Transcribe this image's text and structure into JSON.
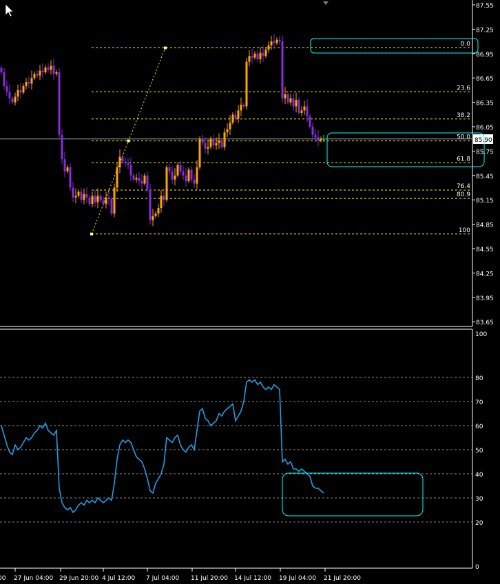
{
  "colors": {
    "background": "#000000",
    "bull": "#ffa500",
    "bear": "#8a2be2",
    "doji": "#00ff00",
    "fib": "#ffff00",
    "bid_line": "#a0a0a0",
    "highlight_box": "#00ffff",
    "rsi_line": "#1e9fe8",
    "grid": "#c0c0c0",
    "axis_text": "#ffffff"
  },
  "price_axis": {
    "labels": [
      "87.55",
      "87.25",
      "86.95",
      "86.65",
      "86.35",
      "86.05",
      "85.75",
      "85.45",
      "85.15",
      "84.85",
      "84.55",
      "84.25",
      "83.95",
      "83.65"
    ],
    "current_price": "85.90"
  },
  "time_axis": {
    "labels": [
      "00",
      "27 Jun 04:00",
      "29 Jun 20:00",
      "4 Jul 12:00",
      "7 Jul 04:00",
      "11 Jul 20:00",
      "14 Jul 12:00",
      "19 Jul 04:00",
      "21 Jul 20:00"
    ]
  },
  "fibonacci": {
    "high": 87.02,
    "low": 84.73,
    "levels": [
      "0.0",
      "23.6",
      "38.2",
      "50.0",
      "61.8",
      "76.4",
      "80.9",
      "100"
    ]
  },
  "closes": [
    86.72,
    86.55,
    86.48,
    86.4,
    86.35,
    86.42,
    86.5,
    86.47,
    86.55,
    86.6,
    86.58,
    86.65,
    86.7,
    86.68,
    86.74,
    86.72,
    86.78,
    86.75,
    86.8,
    86.7,
    86.72,
    85.95,
    85.65,
    85.5,
    85.55,
    85.3,
    85.18,
    85.2,
    85.25,
    85.15,
    85.22,
    85.18,
    85.1,
    85.2,
    85.12,
    85.2,
    85.14,
    85.1,
    85.18,
    85.16,
    84.98,
    85.3,
    85.55,
    85.68,
    85.62,
    85.6,
    85.58,
    85.45,
    85.4,
    85.42,
    85.38,
    85.35,
    85.45,
    85.28,
    84.9,
    84.95,
    84.98,
    85.05,
    85.2,
    85.15,
    85.55,
    85.5,
    85.4,
    85.45,
    85.58,
    85.5,
    85.45,
    85.38,
    85.52,
    85.4,
    85.35,
    85.55,
    85.9,
    85.85,
    85.78,
    85.8,
    85.9,
    85.82,
    85.85,
    85.88,
    85.8,
    85.98,
    86.02,
    86.1,
    86.2,
    86.15,
    86.25,
    86.32,
    86.3,
    86.85,
    86.92,
    86.9,
    86.95,
    86.88,
    86.96,
    86.92,
    87.0,
    87.05,
    87.1,
    87.08,
    87.12,
    87.1,
    86.4,
    86.45,
    86.35,
    86.4,
    86.3,
    86.38,
    86.22,
    86.25,
    86.3,
    86.18,
    86.05,
    85.95,
    85.92,
    85.88,
    85.9,
    85.9
  ],
  "rsi": {
    "levels": [
      80,
      70,
      60,
      50,
      40,
      30,
      20
    ],
    "axis_labels": [
      "100",
      "80",
      "70",
      "60",
      "50",
      "40",
      "30",
      "20",
      "0"
    ],
    "values": [
      60,
      56,
      52,
      49,
      48,
      52,
      50,
      51,
      53,
      55,
      54,
      55,
      57,
      58,
      60,
      59,
      61,
      58,
      57,
      56,
      58,
      34,
      28,
      26,
      25,
      26,
      24,
      25,
      27,
      28,
      27,
      29,
      28,
      29,
      28,
      30,
      29,
      28,
      29,
      30,
      29,
      36,
      46,
      52,
      54,
      53,
      54,
      53,
      50,
      47,
      46,
      45,
      42,
      38,
      33,
      32,
      36,
      38,
      40,
      44,
      55,
      54,
      53,
      55,
      56,
      52,
      50,
      49,
      51,
      52,
      50,
      58,
      66,
      67,
      63,
      62,
      60,
      61,
      62,
      65,
      64,
      66,
      67,
      68,
      69,
      62,
      64,
      66,
      70,
      78,
      79,
      78,
      79,
      77,
      78,
      76,
      75,
      76,
      75,
      77,
      76,
      75,
      45,
      46,
      44,
      45,
      42,
      42,
      41,
      42,
      41,
      40,
      39,
      35,
      34,
      34,
      33,
      32
    ]
  }
}
